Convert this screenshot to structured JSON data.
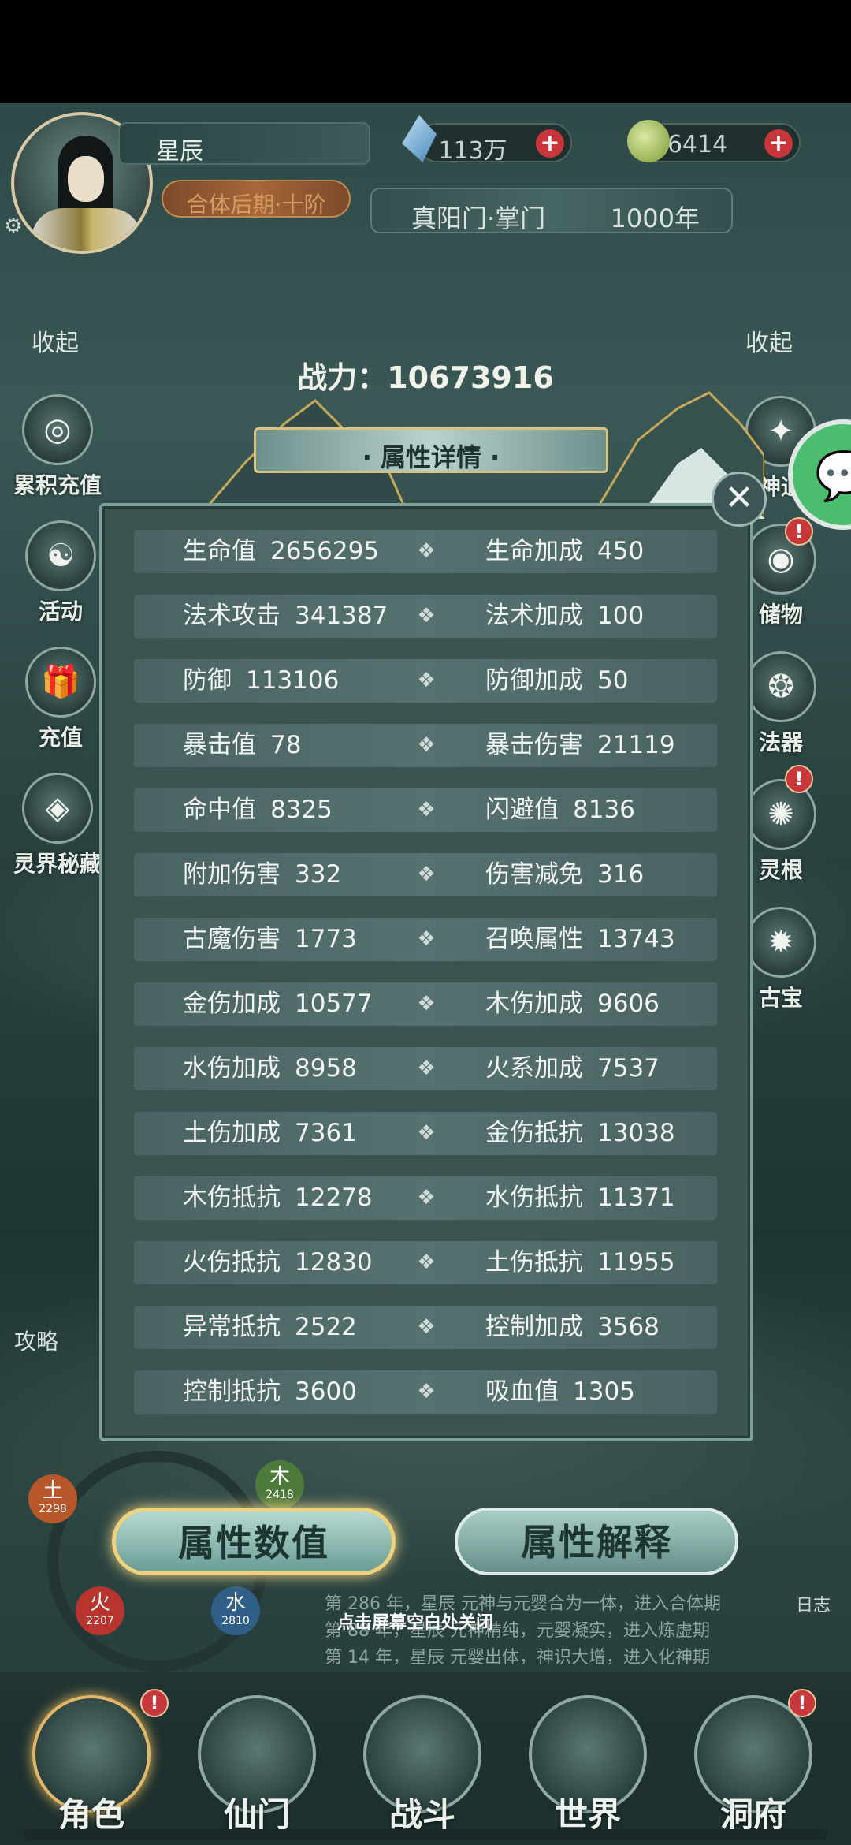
{
  "header": {
    "player_name": "星辰",
    "rank": "合体后期·十阶",
    "spirit_stones": "113万",
    "jade": "6414",
    "sect": "真阳门·掌门",
    "age": "1000年"
  },
  "side_left": {
    "collapse": "收起",
    "items": [
      {
        "label": "累积充值",
        "icon": "gift-ring-icon"
      },
      {
        "label": "活动",
        "icon": "taiji-icon"
      },
      {
        "label": "充值",
        "icon": "gift-box-icon"
      },
      {
        "label": "灵界秘藏",
        "icon": "treasure-icon"
      }
    ],
    "strategy": "攻略"
  },
  "side_right": {
    "collapse": "收起",
    "items": [
      {
        "label": "神通",
        "icon": "skill-icon"
      },
      {
        "label": "储物",
        "icon": "bag-icon"
      },
      {
        "label": "法器",
        "icon": "artifact-icon"
      },
      {
        "label": "灵根",
        "icon": "root-icon"
      },
      {
        "label": "古宝",
        "icon": "ancient-treasure-icon"
      }
    ]
  },
  "power": {
    "label": "战力：",
    "value": "10673916"
  },
  "panel": {
    "title": "· 属性详情 ·",
    "rows": [
      [
        {
          "name": "生命值",
          "value": "2656295"
        },
        {
          "name": "生命加成",
          "value": "450"
        }
      ],
      [
        {
          "name": "法术攻击",
          "value": "341387"
        },
        {
          "name": "法术加成",
          "value": "100"
        }
      ],
      [
        {
          "name": "防御",
          "value": "113106"
        },
        {
          "name": "防御加成",
          "value": "50"
        }
      ],
      [
        {
          "name": "暴击值",
          "value": "78"
        },
        {
          "name": "暴击伤害",
          "value": "21119"
        }
      ],
      [
        {
          "name": "命中值",
          "value": "8325"
        },
        {
          "name": "闪避值",
          "value": "8136"
        }
      ],
      [
        {
          "name": "附加伤害",
          "value": "332"
        },
        {
          "name": "伤害减免",
          "value": "316"
        }
      ],
      [
        {
          "name": "古魔伤害",
          "value": "1773"
        },
        {
          "name": "召唤属性",
          "value": "13743"
        }
      ],
      [
        {
          "name": "金伤加成",
          "value": "10577"
        },
        {
          "name": "木伤加成",
          "value": "9606"
        }
      ],
      [
        {
          "name": "水伤加成",
          "value": "8958"
        },
        {
          "name": "火系加成",
          "value": "7537"
        }
      ],
      [
        {
          "name": "土伤加成",
          "value": "7361"
        },
        {
          "name": "金伤抵抗",
          "value": "13038"
        }
      ],
      [
        {
          "name": "木伤抵抗",
          "value": "12278"
        },
        {
          "name": "水伤抵抗",
          "value": "11371"
        }
      ],
      [
        {
          "name": "火伤抵抗",
          "value": "12830"
        },
        {
          "name": "土伤抵抗",
          "value": "11955"
        }
      ],
      [
        {
          "name": "异常抵抗",
          "value": "2522"
        },
        {
          "name": "控制加成",
          "value": "3568"
        }
      ],
      [
        {
          "name": "控制抵抗",
          "value": "3600"
        },
        {
          "name": "吸血值",
          "value": "1305"
        }
      ]
    ]
  },
  "buttons": {
    "attr_values": "属性数值",
    "attr_explain": "属性解释"
  },
  "hint": "点击屏幕空白处关闭",
  "log": {
    "button": "日志",
    "lines": [
      "第 286 年，星辰 元神与元婴合为一体，进入合体期",
      "第 88 年，星辰 元神精纯，元婴凝实，进入炼虚期",
      "第 14 年，星辰 元婴出体，神识大增，进入化神期"
    ]
  },
  "elements": [
    {
      "name": "土",
      "value": "2298",
      "color": "#b8572a"
    },
    {
      "name": "木",
      "value": "2418",
      "color": "#4d7a3a"
    },
    {
      "name": "火",
      "value": "2207",
      "color": "#b8352f"
    },
    {
      "name": "水",
      "value": "2810",
      "color": "#2f5f86"
    }
  ],
  "nav": [
    {
      "label": "角色",
      "icon": "character-icon"
    },
    {
      "label": "仙门",
      "icon": "sect-gate-icon"
    },
    {
      "label": "战斗",
      "icon": "sword-icon"
    },
    {
      "label": "世界",
      "icon": "world-icon"
    },
    {
      "label": "洞府",
      "icon": "cave-pavilion-icon"
    }
  ],
  "colors": {
    "panel_bg": "#3b5351",
    "accent_gold": "#f0d27c",
    "badge_red": "#c6383c"
  }
}
